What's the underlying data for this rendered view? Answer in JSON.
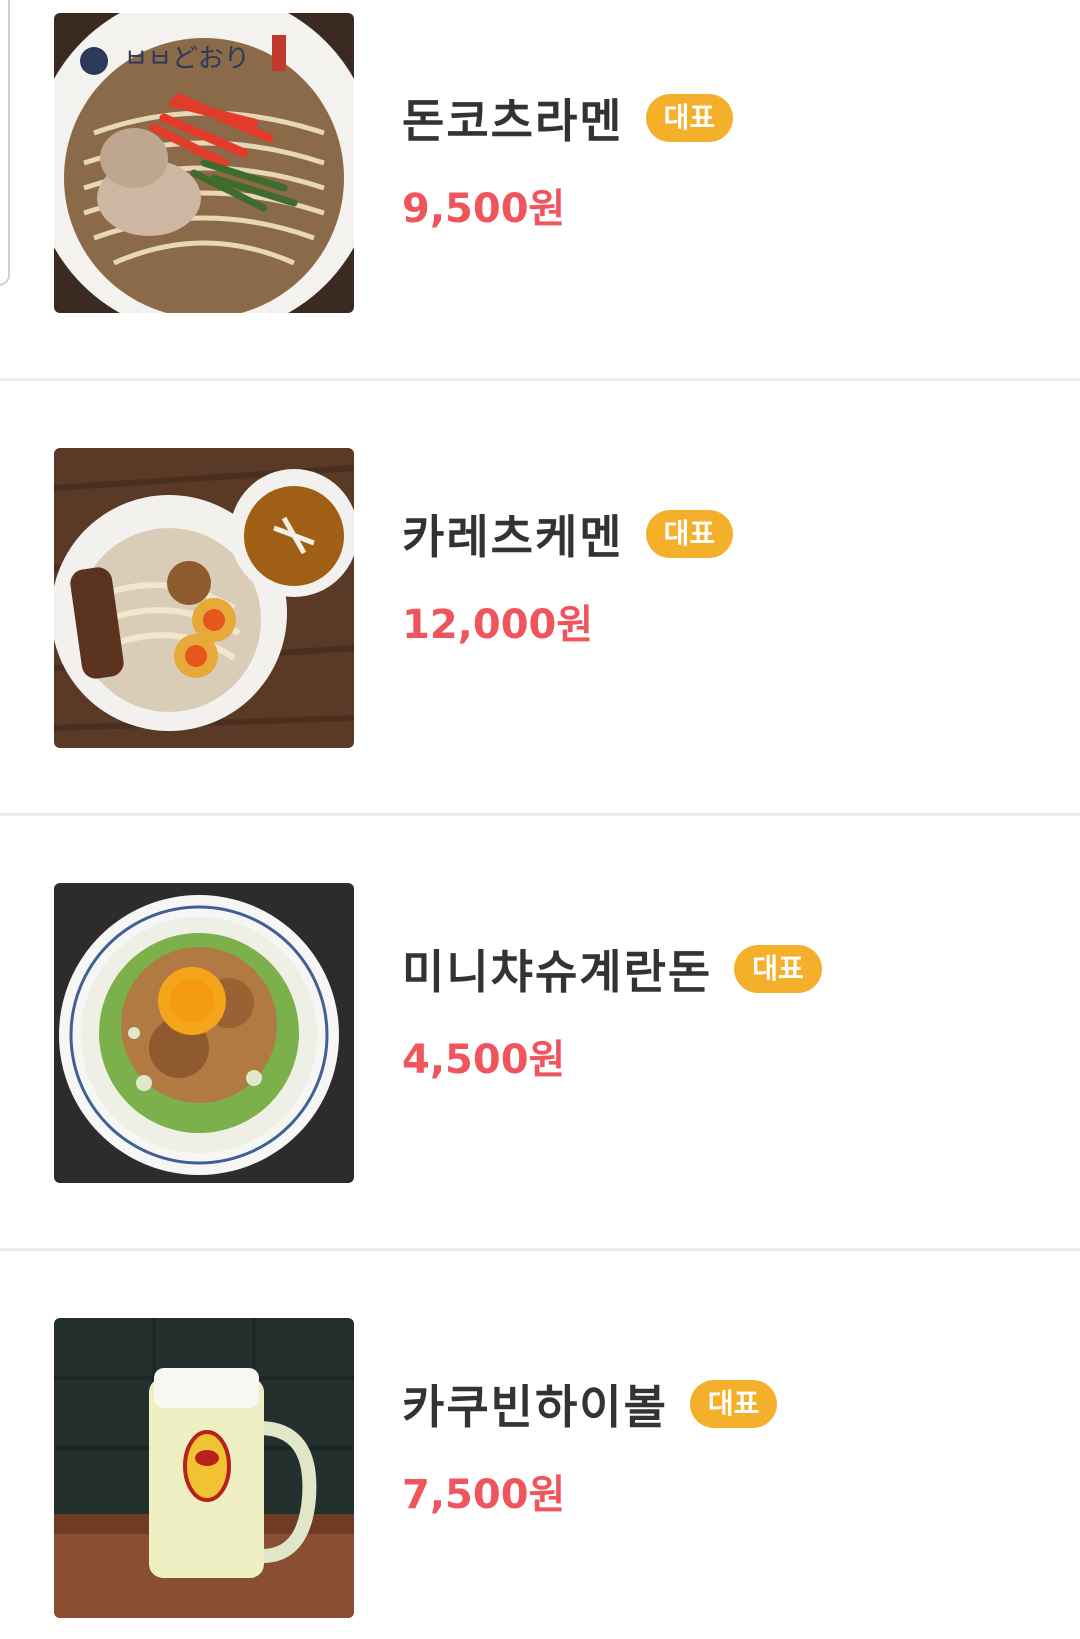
{
  "menu": {
    "items": [
      {
        "name": "돈코츠라멘",
        "badge": "대표",
        "price": "9,500원",
        "image_icon": "ramen-bowl-photo"
      },
      {
        "name": "카레츠케멘",
        "badge": "대표",
        "price": "12,000원",
        "image_icon": "tsukemen-photo"
      },
      {
        "name": "미니챠슈계란돈",
        "badge": "대표",
        "price": "4,500원",
        "image_icon": "rice-bowl-egg-photo"
      },
      {
        "name": "카쿠빈하이볼",
        "badge": "대표",
        "price": "7,500원",
        "image_icon": "highball-mug-photo"
      }
    ]
  },
  "colors": {
    "badge": "#f5b02b",
    "price": "#f0545c",
    "name": "#333333",
    "divider": "#ececec"
  }
}
